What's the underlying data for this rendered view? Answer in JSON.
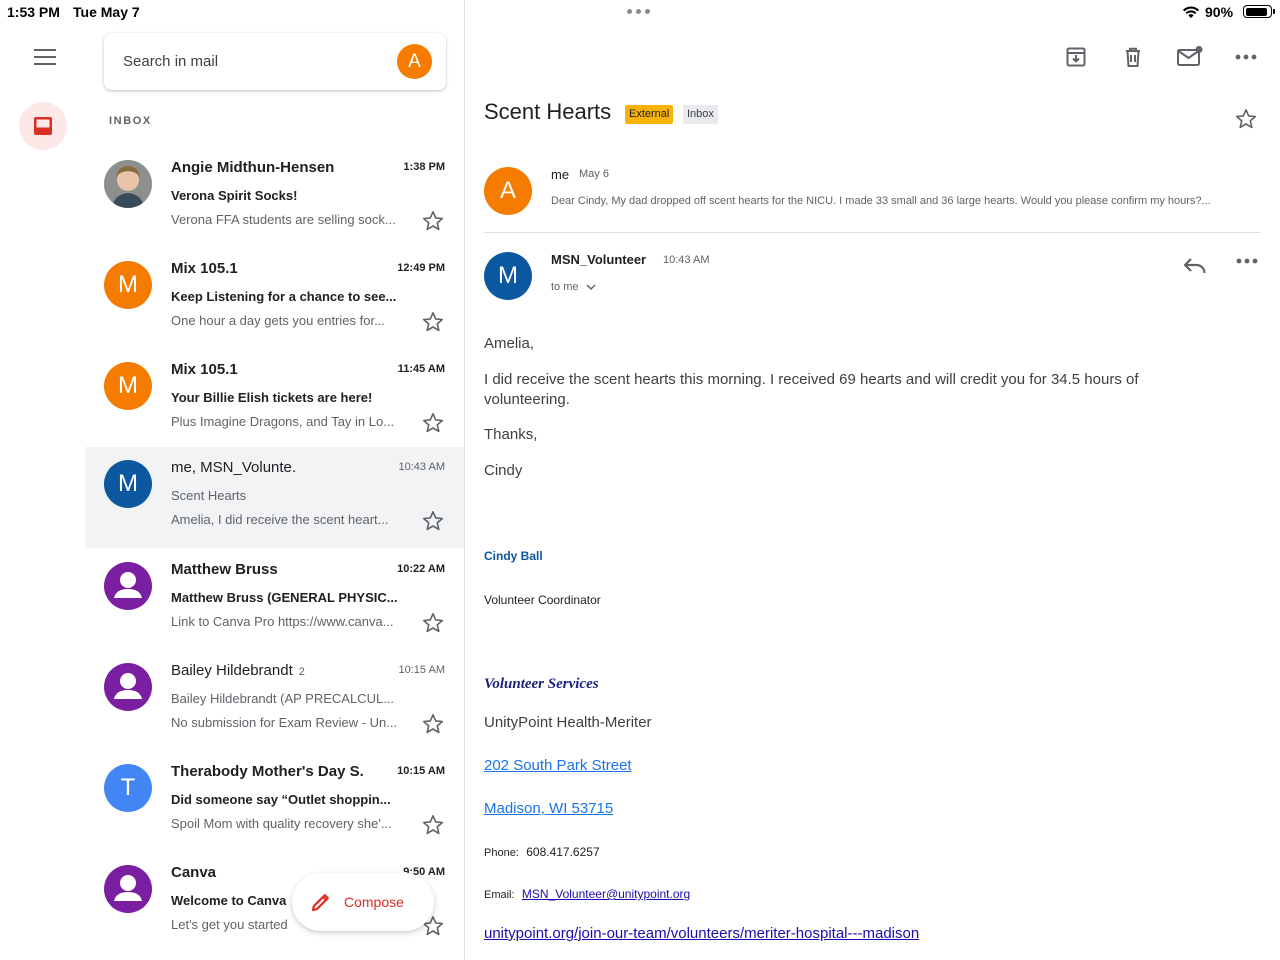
{
  "status_bar": {
    "time": "1:53 PM",
    "date": "Tue May 7",
    "battery": "90%",
    "battery_level": 0.9
  },
  "colors": {
    "accent_red": "#d93025",
    "avatar_orange": "#f57c00",
    "avatar_blue": "#0b57a0",
    "avatar_purple": "#7b1fa2",
    "avatar_lightblue": "#4285f4",
    "badge_external": "#f9b208"
  },
  "search": {
    "placeholder": "Search in mail",
    "account_initial": "A"
  },
  "list": {
    "label": "INBOX",
    "items": [
      {
        "sender": "Angie Midthun-Hensen",
        "time": "1:38 PM",
        "subject": "Verona Spirit Socks!",
        "snippet": "Verona FFA students are selling sock...",
        "avatar": "photo",
        "unread": true
      },
      {
        "sender": "Mix 105.1",
        "time": "12:49 PM",
        "subject": "Keep Listening for a chance to see...",
        "snippet": "One hour a day gets you entries for...",
        "avatar": "M",
        "unread": true
      },
      {
        "sender": "Mix 105.1",
        "time": "11:45 AM",
        "subject": "Your Billie Elish tickets are here!",
        "snippet": "Plus Imagine Dragons, and Tay in Lo...",
        "avatar": "M",
        "unread": true
      },
      {
        "sender": "me, MSN_Volunte.",
        "time": "10:43 AM",
        "subject": "Scent Hearts",
        "snippet": "Amelia, I did receive the scent heart...",
        "avatar": "M",
        "unread": false
      },
      {
        "sender": "Matthew Bruss",
        "time": "10:22 AM",
        "subject": "Matthew Bruss (GENERAL PHYSIC...",
        "snippet": "Link to Canva Pro https://www.canva...",
        "avatar": "person",
        "unread": true
      },
      {
        "sender": "Bailey Hildebrandt",
        "count": "2",
        "time": "10:15 AM",
        "subject": "Bailey Hildebrandt (AP PRECALCUL...",
        "snippet": "No submission for Exam Review - Un...",
        "avatar": "person",
        "unread": false
      },
      {
        "sender": "Therabody Mother's Day S.",
        "time": "10:15 AM",
        "subject": "Did someone say “Outlet shoppin...",
        "snippet": "Spoil Mom with quality recovery she'...",
        "avatar": "T",
        "unread": true
      },
      {
        "sender": "Canva",
        "time": "9:50 AM",
        "subject": "Welcome to Canva",
        "snippet": "Let's get you started",
        "avatar": "person",
        "unread": true
      }
    ]
  },
  "compose": {
    "label": "Compose"
  },
  "message": {
    "title": "Scent Hearts",
    "badges": [
      "External",
      "Inbox"
    ],
    "first": {
      "initial": "A",
      "from": "me",
      "date": "May 6",
      "snippet": "Dear Cindy, My dad dropped off scent hearts for the NICU. I made 33 small and 36 large hearts. Would you please confirm my hours?..."
    },
    "second": {
      "initial": "M",
      "from": "MSN_Volunteer",
      "time": "10:43 AM",
      "to": "to me",
      "greeting": "Amelia,",
      "body1": "I did receive the scent hearts this morning.  I received 69 hearts and will credit you for 34.5 hours of",
      "body2": "volunteering.",
      "thanks": "Thanks,",
      "signoff": "Cindy",
      "sig_name": "Cindy Ball",
      "sig_role": "Volunteer Coordinator",
      "sig_dept": "Volunteer Services",
      "sig_org": "UnityPoint Health-Meriter",
      "sig_addr1": "202 South Park Street",
      "sig_addr2": "Madison, WI 53715",
      "phone_label": "Phone:",
      "phone": "608.417.6257",
      "email_label": "Email:",
      "email": "MSN_Volunteer@unitypoint.org",
      "url": "unitypoint.org/join-our-team/volunteers/meriter-hospital---madison"
    }
  }
}
